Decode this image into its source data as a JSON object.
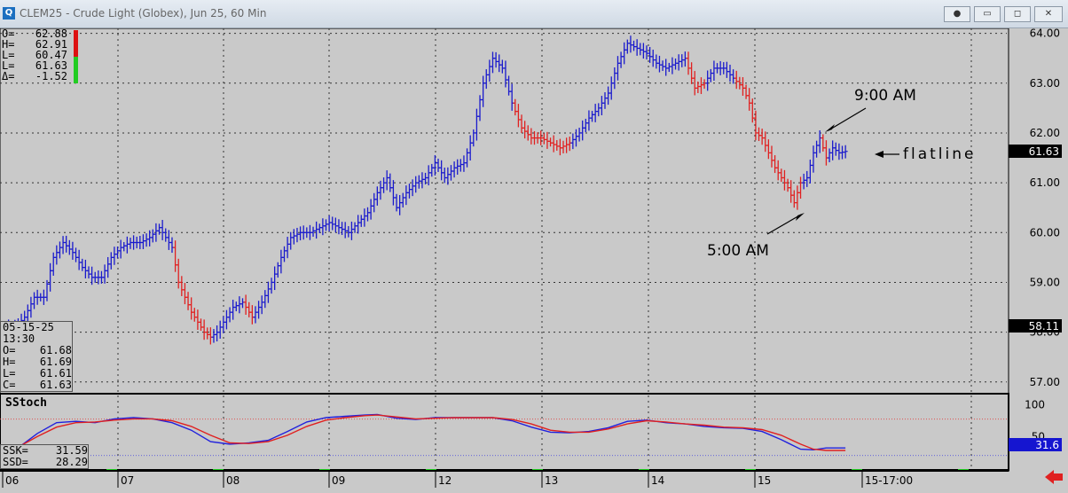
{
  "window": {
    "title": "CLEM25 - Crude Light (Globex), Jun 25, 60 Min",
    "app_icon": "Q",
    "buttons": [
      "record-icon",
      "minimize-icon",
      "restore-icon",
      "close-icon"
    ]
  },
  "ohlc_box": {
    "labels": [
      "O=",
      "H=",
      "L=",
      "L=",
      "Δ="
    ],
    "values": [
      "62.88",
      "62.91",
      "60.47",
      "61.63",
      "-1.52"
    ]
  },
  "cursor_box": {
    "date": "05-15-25",
    "time": "13:30",
    "labels": [
      "O=",
      "H=",
      "L=",
      "C="
    ],
    "values": [
      "61.68",
      "61.69",
      "61.61",
      "61.63"
    ]
  },
  "stoch_box": {
    "title": "SStoch",
    "labels": [
      "SSK=",
      "SSD="
    ],
    "values": [
      "31.59",
      "28.29"
    ]
  },
  "colors": {
    "up": "#1a1acc",
    "down": "#e02020",
    "grid": "#333333",
    "background": "#c9c9c9",
    "ssk": "#2020dd",
    "ssd": "#e02020"
  },
  "chart_data": [
    {
      "type": "ohlc",
      "title": "CLEM25 - Crude Light (Globex), Jun 25, 60 Min",
      "ylim": [
        56.8,
        64.1
      ],
      "yticks": [
        "64.00",
        "63.00",
        "62.00",
        "61.00",
        "60.00",
        "59.00",
        "58.00",
        "57.00"
      ],
      "xticks": [
        "06",
        "07",
        "08",
        "09",
        "12",
        "13",
        "14",
        "15",
        "15-17:00"
      ],
      "last_price": "61.63",
      "cursor_price": "58.11",
      "grid": true,
      "annotations": [
        {
          "text": "9:00 AM",
          "price": 62.0
        },
        {
          "text": "5:00 AM",
          "price": 60.5
        },
        {
          "text": "flatline",
          "price": 61.6
        }
      ],
      "path": [
        [
          0,
          58.1,
          "u"
        ],
        [
          3,
          58.1,
          "u"
        ],
        [
          6,
          58.3,
          "u"
        ],
        [
          9,
          58.7,
          "u"
        ],
        [
          12,
          58.7,
          "u"
        ],
        [
          15,
          59.5,
          "u"
        ],
        [
          18,
          59.8,
          "u"
        ],
        [
          21,
          59.6,
          "u"
        ],
        [
          24,
          59.3,
          "u"
        ],
        [
          27,
          59.1,
          "u"
        ],
        [
          30,
          59.1,
          "u"
        ],
        [
          33,
          59.5,
          "u"
        ],
        [
          36,
          59.7,
          "u"
        ],
        [
          39,
          59.8,
          "u"
        ],
        [
          42,
          59.8,
          "u"
        ],
        [
          45,
          59.9,
          "u"
        ],
        [
          48,
          60.1,
          "u"
        ],
        [
          50,
          59.9,
          "u"
        ],
        [
          52,
          59.7,
          "u"
        ],
        [
          54,
          59.0,
          "d"
        ],
        [
          56,
          58.7,
          "d"
        ],
        [
          58,
          58.4,
          "d"
        ],
        [
          60,
          58.2,
          "d"
        ],
        [
          62,
          58.0,
          "d"
        ],
        [
          64,
          57.9,
          "d"
        ],
        [
          66,
          58.0,
          "u"
        ],
        [
          68,
          58.2,
          "u"
        ],
        [
          71,
          58.5,
          "u"
        ],
        [
          74,
          58.6,
          "u"
        ],
        [
          77,
          58.3,
          "d"
        ],
        [
          80,
          58.6,
          "u"
        ],
        [
          83,
          59.0,
          "u"
        ],
        [
          86,
          59.5,
          "u"
        ],
        [
          89,
          59.9,
          "u"
        ],
        [
          92,
          60.0,
          "u"
        ],
        [
          95,
          60.0,
          "u"
        ],
        [
          98,
          60.1,
          "u"
        ],
        [
          101,
          60.2,
          "u"
        ],
        [
          104,
          60.1,
          "u"
        ],
        [
          107,
          60.0,
          "u"
        ],
        [
          110,
          60.2,
          "u"
        ],
        [
          113,
          60.4,
          "u"
        ],
        [
          116,
          60.8,
          "u"
        ],
        [
          119,
          61.1,
          "u"
        ],
        [
          122,
          60.5,
          "u"
        ],
        [
          125,
          60.8,
          "u"
        ],
        [
          128,
          61.0,
          "u"
        ],
        [
          131,
          61.1,
          "u"
        ],
        [
          134,
          61.4,
          "u"
        ],
        [
          137,
          61.1,
          "u"
        ],
        [
          140,
          61.3,
          "u"
        ],
        [
          143,
          61.4,
          "u"
        ],
        [
          146,
          62.0,
          "u"
        ],
        [
          149,
          63.0,
          "u"
        ],
        [
          152,
          63.5,
          "u"
        ],
        [
          155,
          63.3,
          "u"
        ],
        [
          158,
          62.6,
          "u"
        ],
        [
          161,
          62.1,
          "d"
        ],
        [
          164,
          61.9,
          "d"
        ],
        [
          167,
          61.9,
          "d"
        ],
        [
          170,
          61.8,
          "d"
        ],
        [
          173,
          61.7,
          "d"
        ],
        [
          176,
          61.8,
          "d"
        ],
        [
          179,
          62.0,
          "u"
        ],
        [
          182,
          62.3,
          "u"
        ],
        [
          185,
          62.5,
          "u"
        ],
        [
          188,
          62.8,
          "u"
        ],
        [
          191,
          63.4,
          "u"
        ],
        [
          194,
          63.8,
          "u"
        ],
        [
          197,
          63.7,
          "u"
        ],
        [
          200,
          63.6,
          "u"
        ],
        [
          203,
          63.4,
          "u"
        ],
        [
          206,
          63.3,
          "u"
        ],
        [
          209,
          63.4,
          "u"
        ],
        [
          212,
          63.5,
          "u"
        ],
        [
          215,
          62.9,
          "d"
        ],
        [
          218,
          63.0,
          "d"
        ],
        [
          221,
          63.3,
          "u"
        ],
        [
          224,
          63.3,
          "u"
        ],
        [
          227,
          63.1,
          "u"
        ],
        [
          230,
          62.9,
          "d"
        ],
        [
          232,
          62.6,
          "d"
        ],
        [
          234,
          62.0,
          "d"
        ],
        [
          236,
          61.9,
          "d"
        ],
        [
          238,
          61.6,
          "d"
        ],
        [
          240,
          61.3,
          "d"
        ],
        [
          242,
          61.1,
          "d"
        ],
        [
          244,
          60.9,
          "d"
        ],
        [
          246,
          60.6,
          "d"
        ],
        [
          248,
          61.0,
          "d"
        ],
        [
          250,
          61.1,
          "u"
        ],
        [
          252,
          61.6,
          "u"
        ],
        [
          254,
          61.9,
          "u"
        ],
        [
          256,
          61.5,
          "d"
        ],
        [
          258,
          61.7,
          "u"
        ],
        [
          260,
          61.6,
          "u"
        ],
        [
          262,
          61.63,
          "u"
        ]
      ]
    },
    {
      "type": "line",
      "title": "SStoch",
      "ylim": [
        0,
        115
      ],
      "yticks": [
        "100",
        "50"
      ],
      "last_value": "31.6",
      "series": [
        {
          "name": "SSK",
          "points": [
            [
              0,
              36
            ],
            [
              5,
              36
            ],
            [
              10,
              55
            ],
            [
              16,
              72
            ],
            [
              22,
              74
            ],
            [
              28,
              72
            ],
            [
              34,
              78
            ],
            [
              40,
              80
            ],
            [
              46,
              78
            ],
            [
              52,
              72
            ],
            [
              58,
              60
            ],
            [
              64,
              42
            ],
            [
              70,
              38
            ],
            [
              76,
              40
            ],
            [
              82,
              44
            ],
            [
              88,
              58
            ],
            [
              94,
              73
            ],
            [
              100,
              80
            ],
            [
              106,
              82
            ],
            [
              112,
              84
            ],
            [
              116,
              85
            ],
            [
              122,
              79
            ],
            [
              128,
              77
            ],
            [
              134,
              80
            ],
            [
              140,
              80
            ],
            [
              146,
              80
            ],
            [
              152,
              80
            ],
            [
              158,
              75
            ],
            [
              164,
              65
            ],
            [
              170,
              57
            ],
            [
              176,
              56
            ],
            [
              182,
              58
            ],
            [
              188,
              64
            ],
            [
              194,
              74
            ],
            [
              200,
              76
            ],
            [
              206,
              72
            ],
            [
              212,
              70
            ],
            [
              218,
              66
            ],
            [
              224,
              64
            ],
            [
              230,
              63
            ],
            [
              236,
              58
            ],
            [
              242,
              45
            ],
            [
              248,
              30
            ],
            [
              252,
              29
            ],
            [
              256,
              32
            ],
            [
              262,
              32
            ]
          ]
        },
        {
          "name": "SSD",
          "points": [
            [
              0,
              36
            ],
            [
              5,
              36
            ],
            [
              10,
              50
            ],
            [
              16,
              65
            ],
            [
              22,
              72
            ],
            [
              28,
              73
            ],
            [
              34,
              76
            ],
            [
              40,
              78
            ],
            [
              46,
              78
            ],
            [
              52,
              75
            ],
            [
              58,
              66
            ],
            [
              64,
              52
            ],
            [
              70,
              40
            ],
            [
              76,
              39
            ],
            [
              82,
              42
            ],
            [
              88,
              52
            ],
            [
              94,
              66
            ],
            [
              100,
              76
            ],
            [
              106,
              80
            ],
            [
              112,
              83
            ],
            [
              116,
              84
            ],
            [
              122,
              81
            ],
            [
              128,
              78
            ],
            [
              134,
              79
            ],
            [
              140,
              80
            ],
            [
              146,
              80
            ],
            [
              152,
              80
            ],
            [
              158,
              77
            ],
            [
              164,
              70
            ],
            [
              170,
              60
            ],
            [
              176,
              57
            ],
            [
              182,
              57
            ],
            [
              188,
              62
            ],
            [
              194,
              70
            ],
            [
              200,
              75
            ],
            [
              206,
              73
            ],
            [
              212,
              70
            ],
            [
              218,
              68
            ],
            [
              224,
              65
            ],
            [
              230,
              64
            ],
            [
              236,
              61
            ],
            [
              242,
              52
            ],
            [
              248,
              38
            ],
            [
              252,
              30
            ],
            [
              256,
              28
            ],
            [
              262,
              28
            ]
          ]
        }
      ],
      "reference_lines": [
        100,
        20
      ]
    }
  ]
}
